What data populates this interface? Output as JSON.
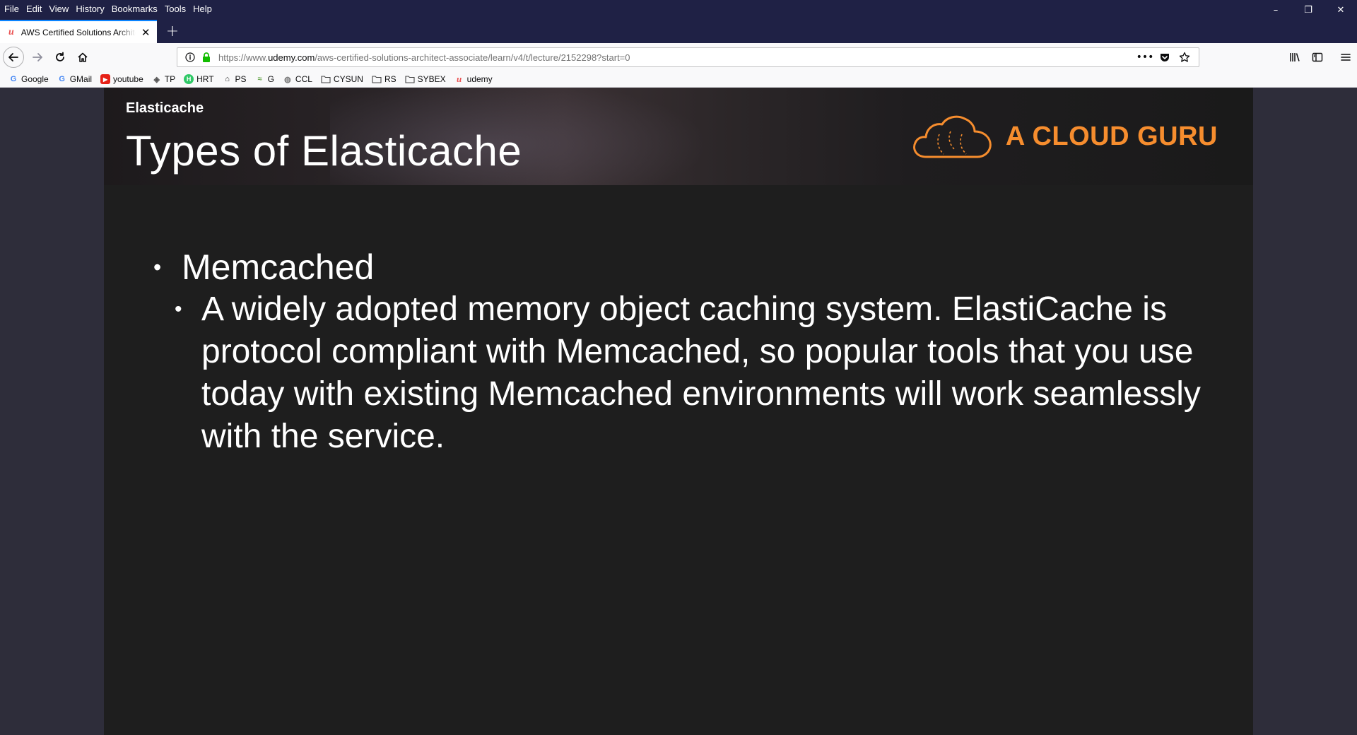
{
  "menu": [
    "File",
    "Edit",
    "View",
    "History",
    "Bookmarks",
    "Tools",
    "Help"
  ],
  "window_controls": {
    "minimize": "–",
    "restore": "❐",
    "close": "✕"
  },
  "tab": {
    "title": "AWS Certified Solutions Architect",
    "close": "✕",
    "new_tab": "+"
  },
  "urlbar": {
    "prefix": "https://www.",
    "host": "udemy.com",
    "path": "/aws-certified-solutions-architect-associate/learn/v4/t/lecture/2152298?start=0",
    "more": "•••"
  },
  "bookmarks": [
    {
      "label": "Google",
      "icon": "G",
      "color": "#4285f4"
    },
    {
      "label": "GMail",
      "icon": "G",
      "color": "#4285f4"
    },
    {
      "label": "youtube",
      "icon": "▶",
      "color": "#e62117"
    },
    {
      "label": "TP",
      "icon": "◈",
      "color": "#555555"
    },
    {
      "label": "HRT",
      "icon": "H",
      "color": "#2ec866"
    },
    {
      "label": "PS",
      "icon": "⌂",
      "color": "#222222"
    },
    {
      "label": "G",
      "icon": "≈",
      "color": "#6aa84f"
    },
    {
      "label": "CCL",
      "icon": "◍",
      "color": "#7a7a7a"
    },
    {
      "label": "CYSUN",
      "icon": "▭",
      "color": "#444444"
    },
    {
      "label": "RS",
      "icon": "▭",
      "color": "#444444"
    },
    {
      "label": "SYBEX",
      "icon": "▭",
      "color": "#444444"
    },
    {
      "label": "udemy",
      "icon": "u",
      "color": "#ea5252"
    }
  ],
  "slide": {
    "section": "Elasticache",
    "title": "Types of Elasticache",
    "brand": "A CLOUD GURU",
    "brand_color": "#f68d2e",
    "bullet_1": "Memcached",
    "bullet_1_1": "A widely adopted memory object caching system. ElastiCache is protocol compliant with Memcached, so popular tools that you use today with existing Memcached environments will work seamlessly with the service."
  }
}
